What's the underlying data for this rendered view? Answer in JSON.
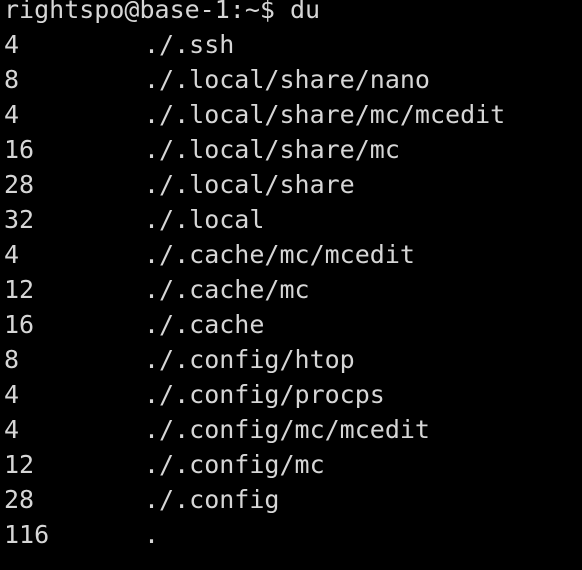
{
  "terminal": {
    "prompt": "rightspo@base-1:~$ du",
    "colors": {
      "background": "#000000",
      "foreground": "#d6d6d6"
    },
    "rows": [
      {
        "size": "4",
        "path": "./.ssh"
      },
      {
        "size": "8",
        "path": "./.local/share/nano"
      },
      {
        "size": "4",
        "path": "./.local/share/mc/mcedit"
      },
      {
        "size": "16",
        "path": "./.local/share/mc"
      },
      {
        "size": "28",
        "path": "./.local/share"
      },
      {
        "size": "32",
        "path": "./.local"
      },
      {
        "size": "4",
        "path": "./.cache/mc/mcedit"
      },
      {
        "size": "12",
        "path": "./.cache/mc"
      },
      {
        "size": "16",
        "path": "./.cache"
      },
      {
        "size": "8",
        "path": "./.config/htop"
      },
      {
        "size": "4",
        "path": "./.config/procps"
      },
      {
        "size": "4",
        "path": "./.config/mc/mcedit"
      },
      {
        "size": "12",
        "path": "./.config/mc"
      },
      {
        "size": "28",
        "path": "./.config"
      },
      {
        "size": "116",
        "path": "."
      }
    ]
  }
}
